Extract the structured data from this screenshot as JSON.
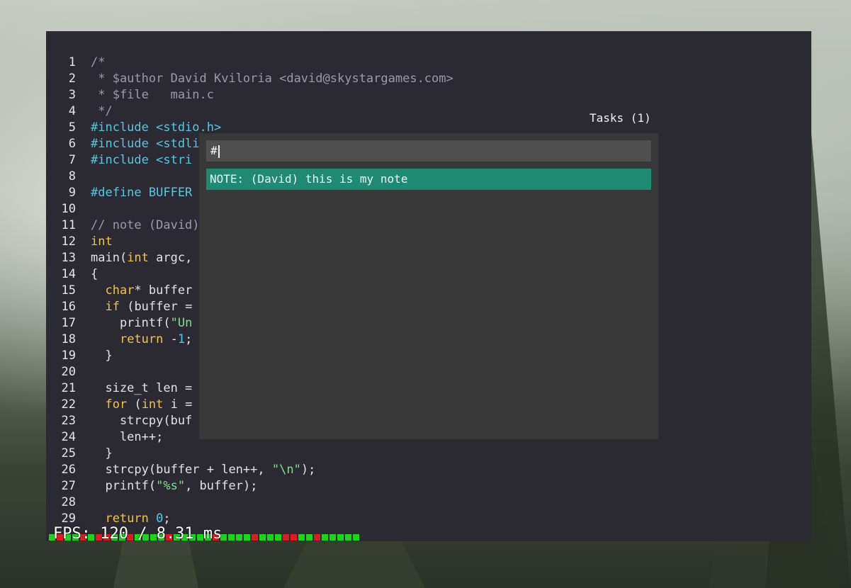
{
  "colors": {
    "window_bg": "#2b2a33",
    "comment": "#9b9ba8",
    "preprocessor": "#57c8e0",
    "keyword": "#f2c542",
    "string": "#7ee08a",
    "selection": "#1f8a72"
  },
  "editor": {
    "lines": [
      {
        "n": "1",
        "tokens": [
          {
            "c": "cm",
            "t": "/*"
          }
        ]
      },
      {
        "n": "2",
        "tokens": [
          {
            "c": "cm",
            "t": " * $author David Kviloria <david@skystargames.com>"
          }
        ]
      },
      {
        "n": "3",
        "tokens": [
          {
            "c": "cm",
            "t": " * $file   main.c"
          }
        ]
      },
      {
        "n": "4",
        "tokens": [
          {
            "c": "cm",
            "t": " */"
          }
        ]
      },
      {
        "n": "5",
        "tokens": [
          {
            "c": "pp",
            "t": "#include <stdio.h>"
          }
        ]
      },
      {
        "n": "6",
        "tokens": [
          {
            "c": "pp",
            "t": "#include <stdli"
          }
        ]
      },
      {
        "n": "7",
        "tokens": [
          {
            "c": "pp",
            "t": "#include <stri"
          }
        ]
      },
      {
        "n": "8",
        "tokens": []
      },
      {
        "n": "9",
        "tokens": [
          {
            "c": "pp",
            "t": "#define BUFFER"
          }
        ]
      },
      {
        "n": "10",
        "tokens": []
      },
      {
        "n": "11",
        "tokens": [
          {
            "c": "cm",
            "t": "// note (David)"
          }
        ]
      },
      {
        "n": "12",
        "tokens": [
          {
            "c": "kw",
            "t": "int"
          }
        ]
      },
      {
        "n": "13",
        "tokens": [
          {
            "c": "code",
            "t": "main("
          },
          {
            "c": "kw",
            "t": "int"
          },
          {
            "c": "code",
            "t": " argc,"
          }
        ]
      },
      {
        "n": "14",
        "tokens": [
          {
            "c": "code",
            "t": "{"
          }
        ]
      },
      {
        "n": "15",
        "tokens": [
          {
            "c": "code",
            "t": "  "
          },
          {
            "c": "kw",
            "t": "char"
          },
          {
            "c": "code",
            "t": "* buffer"
          }
        ]
      },
      {
        "n": "16",
        "tokens": [
          {
            "c": "code",
            "t": "  "
          },
          {
            "c": "kw",
            "t": "if"
          },
          {
            "c": "code",
            "t": " (buffer ="
          }
        ]
      },
      {
        "n": "17",
        "tokens": [
          {
            "c": "code",
            "t": "    printf("
          },
          {
            "c": "str",
            "t": "\"Un"
          }
        ]
      },
      {
        "n": "18",
        "tokens": [
          {
            "c": "code",
            "t": "    "
          },
          {
            "c": "kw",
            "t": "return"
          },
          {
            "c": "code",
            "t": " -"
          },
          {
            "c": "num",
            "t": "1"
          },
          {
            "c": "code",
            "t": ";"
          }
        ]
      },
      {
        "n": "19",
        "tokens": [
          {
            "c": "code",
            "t": "  }"
          }
        ]
      },
      {
        "n": "20",
        "tokens": []
      },
      {
        "n": "21",
        "tokens": [
          {
            "c": "code",
            "t": "  size_t len ="
          }
        ]
      },
      {
        "n": "22",
        "tokens": [
          {
            "c": "code",
            "t": "  "
          },
          {
            "c": "kw",
            "t": "for"
          },
          {
            "c": "code",
            "t": " ("
          },
          {
            "c": "kw",
            "t": "int"
          },
          {
            "c": "code",
            "t": " i ="
          }
        ]
      },
      {
        "n": "23",
        "tokens": [
          {
            "c": "code",
            "t": "    strcpy(buf"
          }
        ]
      },
      {
        "n": "24",
        "tokens": [
          {
            "c": "code",
            "t": "    len++;"
          }
        ]
      },
      {
        "n": "25",
        "tokens": [
          {
            "c": "code",
            "t": "  }"
          }
        ]
      },
      {
        "n": "26",
        "tokens": [
          {
            "c": "code",
            "t": "  strcpy(buffer + len++, "
          },
          {
            "c": "str",
            "t": "\"\\n\""
          },
          {
            "c": "code",
            "t": ");"
          }
        ]
      },
      {
        "n": "27",
        "tokens": [
          {
            "c": "code",
            "t": "  printf("
          },
          {
            "c": "str",
            "t": "\"%s\""
          },
          {
            "c": "code",
            "t": ", buffer);"
          }
        ]
      },
      {
        "n": "28",
        "tokens": []
      },
      {
        "n": "29",
        "tokens": [
          {
            "c": "code",
            "t": "  "
          },
          {
            "c": "kw",
            "t": "return"
          },
          {
            "c": "code",
            "t": " "
          },
          {
            "c": "num",
            "t": "0"
          },
          {
            "c": "code",
            "t": ";"
          }
        ]
      }
    ]
  },
  "tasks": {
    "title": "Tasks (1)",
    "input_value": "#",
    "items": [
      "NOTE: (David) this is my note"
    ]
  },
  "fps": {
    "text": "FPS: 120 / 8.31 ms",
    "bar_colors": [
      "green",
      "red",
      "green",
      "green",
      "red",
      "green",
      "red",
      "red",
      "green",
      "green",
      "red",
      "green",
      "green",
      "green",
      "green",
      "red",
      "green",
      "green",
      "green",
      "green",
      "green",
      "red",
      "green",
      "green",
      "green",
      "green",
      "red",
      "green",
      "green",
      "green",
      "red",
      "red",
      "green",
      "green",
      "red",
      "green",
      "green",
      "green",
      "green",
      "green"
    ]
  }
}
